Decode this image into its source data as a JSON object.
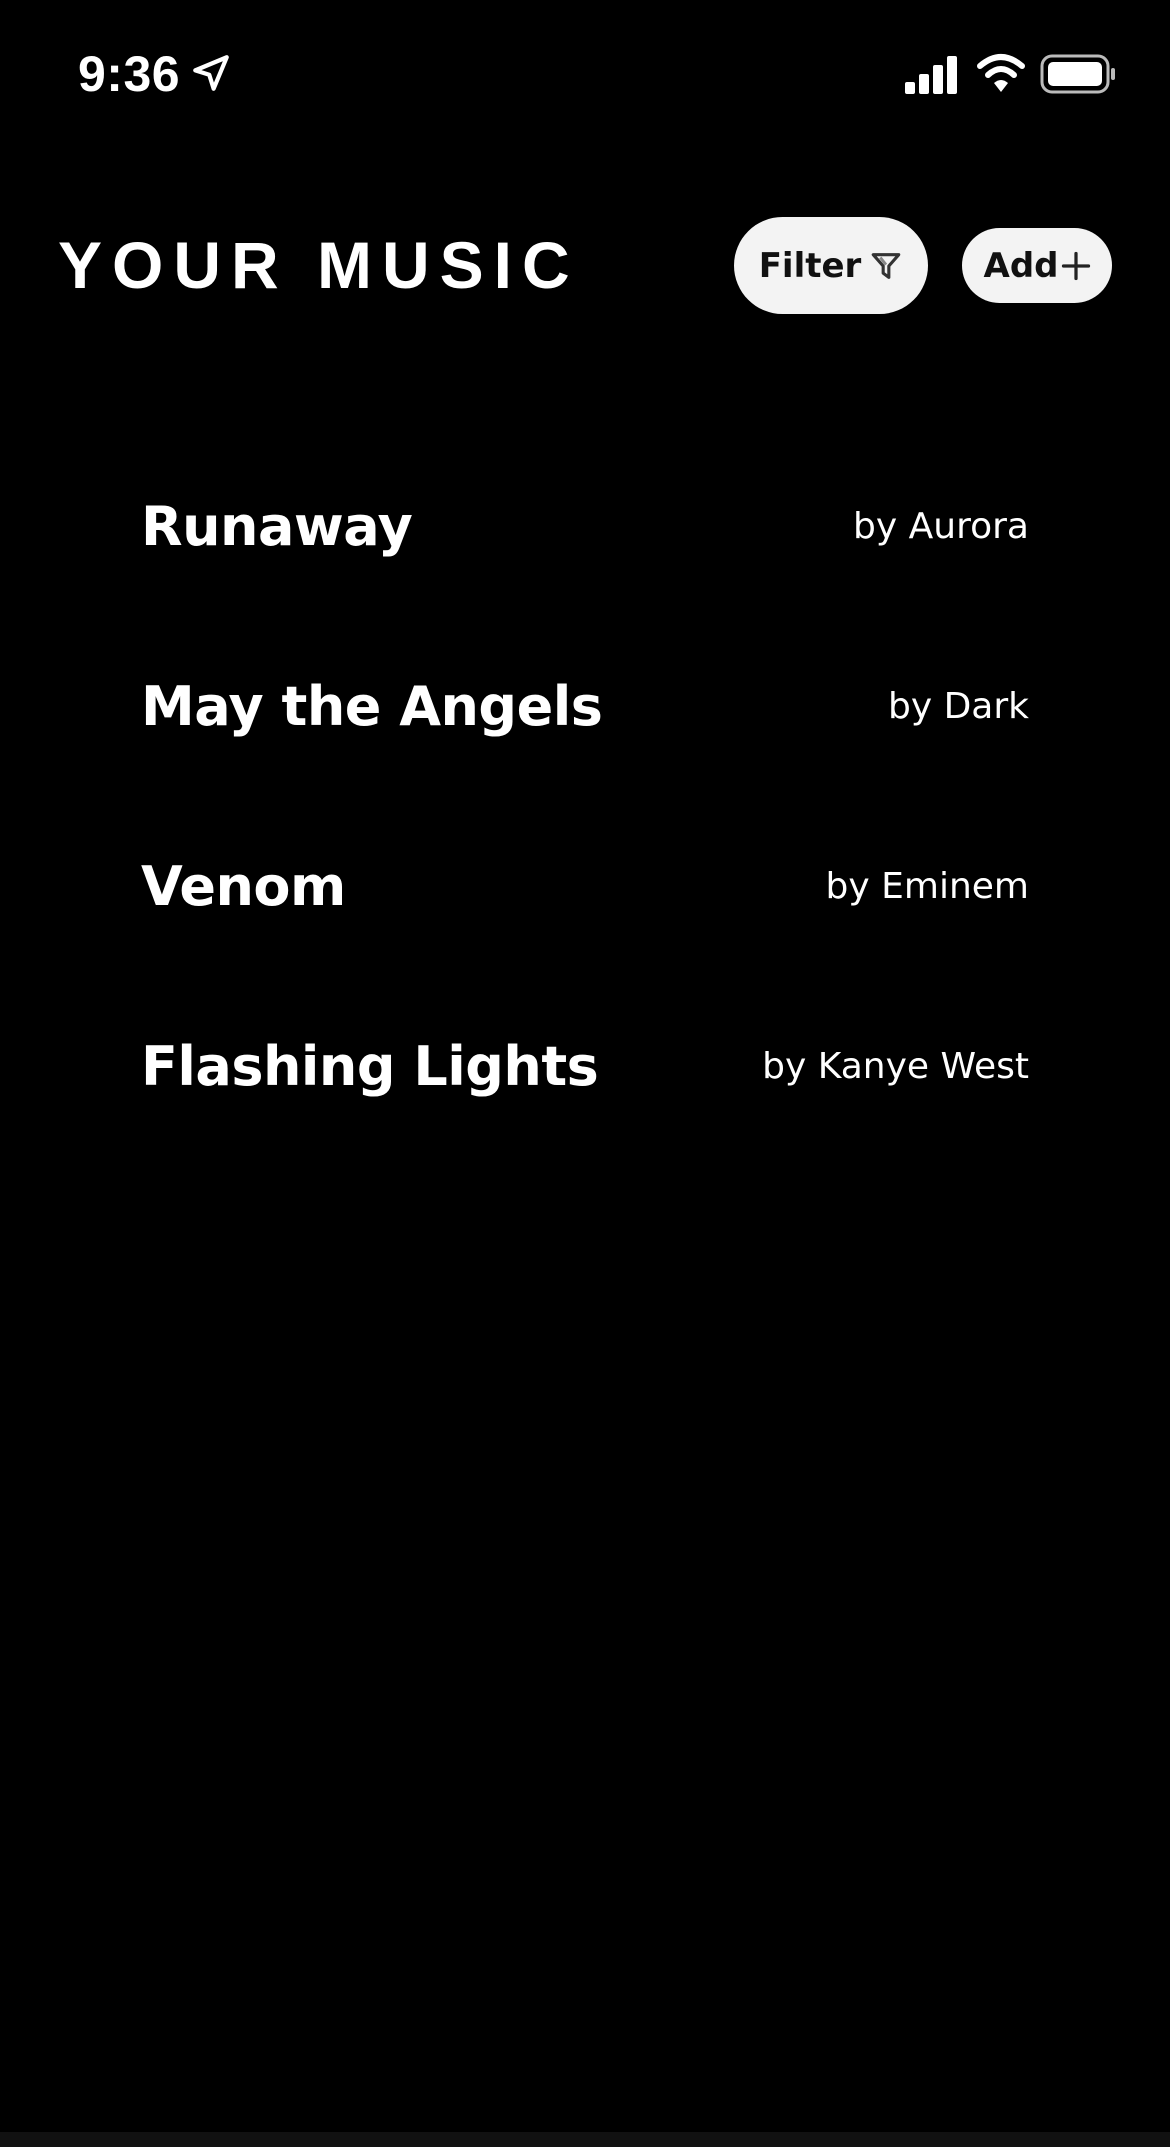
{
  "status_bar": {
    "time": "9:36",
    "icons": [
      "location-arrow-icon",
      "cellular-signal-icon",
      "wifi-icon",
      "battery-icon"
    ]
  },
  "header": {
    "title": "YOUR MUSIC",
    "filter_label": "Filter",
    "add_label": "Add"
  },
  "songs": [
    {
      "title": "Runaway",
      "artist": "by Aurora"
    },
    {
      "title": "May the Angels",
      "artist": "by Dark"
    },
    {
      "title": "Venom",
      "artist": "by Eminem"
    },
    {
      "title": "Flashing Lights",
      "artist": "by Kanye West"
    }
  ],
  "colors": {
    "background": "#000000",
    "text": "#ffffff",
    "button_background": "#f3f3f3",
    "button_text": "#111111"
  }
}
